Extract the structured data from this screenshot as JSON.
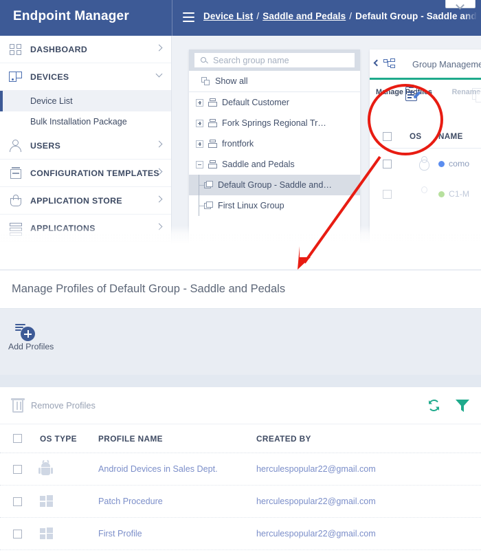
{
  "topbar": {
    "brand": "Endpoint Manager",
    "menu_icon": "hamburger-icon",
    "breadcrumb": [
      {
        "label": "Device List",
        "link": true
      },
      {
        "label": "Saddle and Pedals",
        "link": true
      },
      {
        "label": "Default Group - Saddle and Pedals",
        "link": false
      }
    ],
    "separator": "/"
  },
  "sidebar": {
    "items": [
      {
        "label": "DASHBOARD",
        "icon": "grid-icon",
        "chevron": "right"
      },
      {
        "label": "DEVICES",
        "icon": "device-icon",
        "chevron": "down"
      },
      {
        "label": "USERS",
        "icon": "user-icon",
        "chevron": "right"
      },
      {
        "label": "CONFIGURATION TEMPLATES",
        "icon": "template-icon",
        "chevron": "right"
      },
      {
        "label": "APPLICATION STORE",
        "icon": "basket-icon",
        "chevron": "right"
      },
      {
        "label": "APPLICATIONS",
        "icon": "server-icon",
        "chevron": "right"
      }
    ],
    "sub_items": [
      {
        "label": "Device List",
        "active": true
      },
      {
        "label": "Bulk Installation Package",
        "active": false
      }
    ]
  },
  "tree_panel": {
    "search_placeholder": "Search group name",
    "search_value": "",
    "search_icon": "search-icon",
    "show_all": {
      "label": "Show all",
      "icon": "copy-icon"
    },
    "nodes": [
      {
        "label": "Default Customer",
        "toggle": "plus",
        "icon": "company-icon",
        "child": false,
        "selected": false
      },
      {
        "label": "Fork Springs Regional Tr…",
        "toggle": "plus",
        "icon": "company-icon",
        "child": false,
        "selected": false
      },
      {
        "label": "frontfork",
        "toggle": "plus",
        "icon": "company-icon",
        "child": false,
        "selected": false
      },
      {
        "label": "Saddle and Pedals",
        "toggle": "minus",
        "icon": "company-icon",
        "child": false,
        "selected": false
      },
      {
        "label": "Default Group - Saddle and…",
        "toggle": "none",
        "icon": "folder-icon",
        "child": true,
        "selected": true
      },
      {
        "label": "First Linux Group",
        "toggle": "none",
        "icon": "folder-icon",
        "child": true,
        "selected": false
      }
    ]
  },
  "device_panel": {
    "tab_label": "Group Management",
    "back_icon": "chevron-left-icon",
    "tab_icon": "org-tree-icon",
    "tools": [
      {
        "label": "Manage Profiles",
        "icon": "manage-profiles-icon",
        "disabled": false
      },
      {
        "label": "Rename G",
        "icon": "rename-group-icon",
        "disabled": true
      }
    ],
    "columns": [
      "OS",
      "NAME"
    ],
    "rows": [
      {
        "os": "linux-icon",
        "status_color": "#5b8def",
        "name": "como"
      },
      {
        "os": "apple-icon",
        "status_color": "#7ec850",
        "name": "C1-M"
      }
    ]
  },
  "annotation": {
    "circle_color": "#e81c12",
    "arrow_color": "#e81c12",
    "target": "Manage Profiles"
  },
  "manage_panel": {
    "title": "Manage Profiles of Default Group - Saddle and Pedals",
    "add_button": {
      "label": "Add Profiles",
      "icon": "add-profiles-icon"
    },
    "toolbar": {
      "remove_label": "Remove Profiles",
      "remove_icon": "trash-icon",
      "refresh_icon": "refresh-icon",
      "filter_icon": "filter-icon",
      "accent_color": "#1faa8c"
    },
    "columns": [
      "OS TYPE",
      "PROFILE NAME",
      "CREATED BY"
    ],
    "rows": [
      {
        "os": "android-icon",
        "profile_name": "Android Devices in Sales Dept.",
        "created_by": "herculespopular22@gmail.com"
      },
      {
        "os": "windows-icon",
        "profile_name": "Patch Procedure",
        "created_by": "herculespopular22@gmail.com"
      },
      {
        "os": "windows-icon",
        "profile_name": "First Profile",
        "created_by": "herculespopular22@gmail.com"
      }
    ]
  }
}
